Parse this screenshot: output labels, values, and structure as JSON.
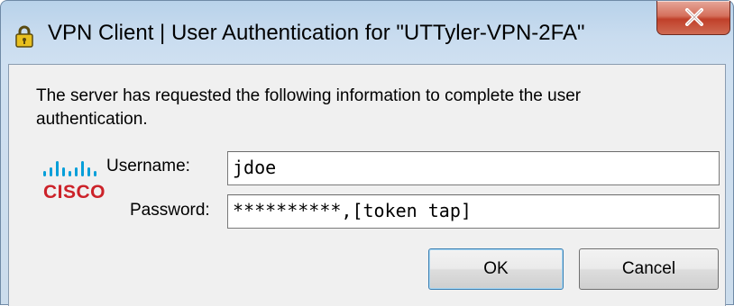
{
  "window": {
    "title": "VPN Client  |  User Authentication for \"UTTyler-VPN-2FA\"",
    "icon": "vpn-lock-icon",
    "close_icon": "close-icon"
  },
  "dialog": {
    "message": "The server has requested the following information to complete the user authentication.",
    "logo": {
      "name": "cisco-logo",
      "wordmark": "CISCO"
    },
    "fields": {
      "username": {
        "label": "Username:",
        "value": "jdoe"
      },
      "password": {
        "label": "Password:",
        "value": "**********,[token tap]"
      }
    },
    "buttons": {
      "ok": "OK",
      "cancel": "Cancel"
    }
  },
  "colors": {
    "cisco_red": "#cc2229",
    "cisco_blue": "#049fd9",
    "close_red": "#c0402a",
    "title_gradient": "#c9dcef"
  }
}
